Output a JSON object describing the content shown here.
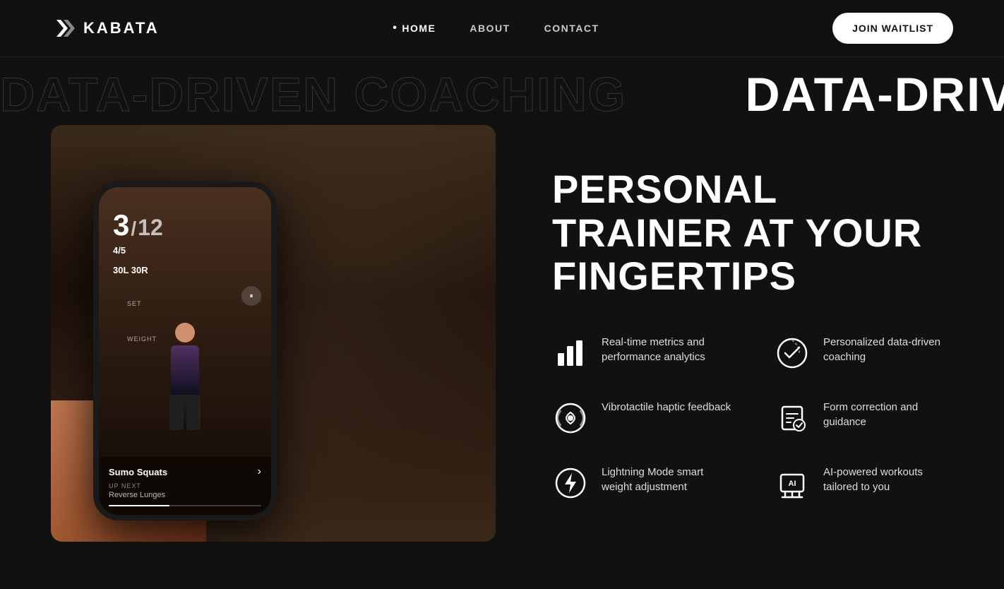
{
  "nav": {
    "logo_text": "KABATA",
    "links": [
      {
        "id": "home",
        "label": "HOME",
        "active": true
      },
      {
        "id": "about",
        "label": "ABOUT",
        "active": false
      },
      {
        "id": "contact",
        "label": "CONTACT",
        "active": false
      }
    ],
    "cta_label": "JOIN WAITLIST"
  },
  "ticker": {
    "text": "DATA-DRIVEN COACHING",
    "repeat": 4
  },
  "hero": {
    "headline_line1": "PERSONAL TRAINER AT YOUR",
    "headline_line2": "FINGERTIPS"
  },
  "phone_screen": {
    "rep_current": "3",
    "rep_divider": "/",
    "rep_total": "12",
    "set_label": "SET",
    "set_value": "4/5",
    "weight_label": "WEIGHT",
    "weight_value": "30L  30R",
    "exercise_name": "Sumo Squats",
    "next_label": "UP NEXT",
    "next_exercise": "Reverse Lunges"
  },
  "features": [
    {
      "id": "metrics",
      "icon": "bar-chart-icon",
      "label": "Real-time metrics and performance analytics"
    },
    {
      "id": "coaching",
      "icon": "coaching-icon",
      "label": "Personalized data-driven coaching"
    },
    {
      "id": "haptic",
      "icon": "haptic-icon",
      "label": "Vibrotactile haptic feedback"
    },
    {
      "id": "form",
      "icon": "form-icon",
      "label": "Form correction and guidance"
    },
    {
      "id": "lightning",
      "icon": "lightning-icon",
      "label": "Lightning Mode smart weight adjustment"
    },
    {
      "id": "ai",
      "icon": "ai-icon",
      "label": "AI-powered workouts tailored to you"
    }
  ]
}
